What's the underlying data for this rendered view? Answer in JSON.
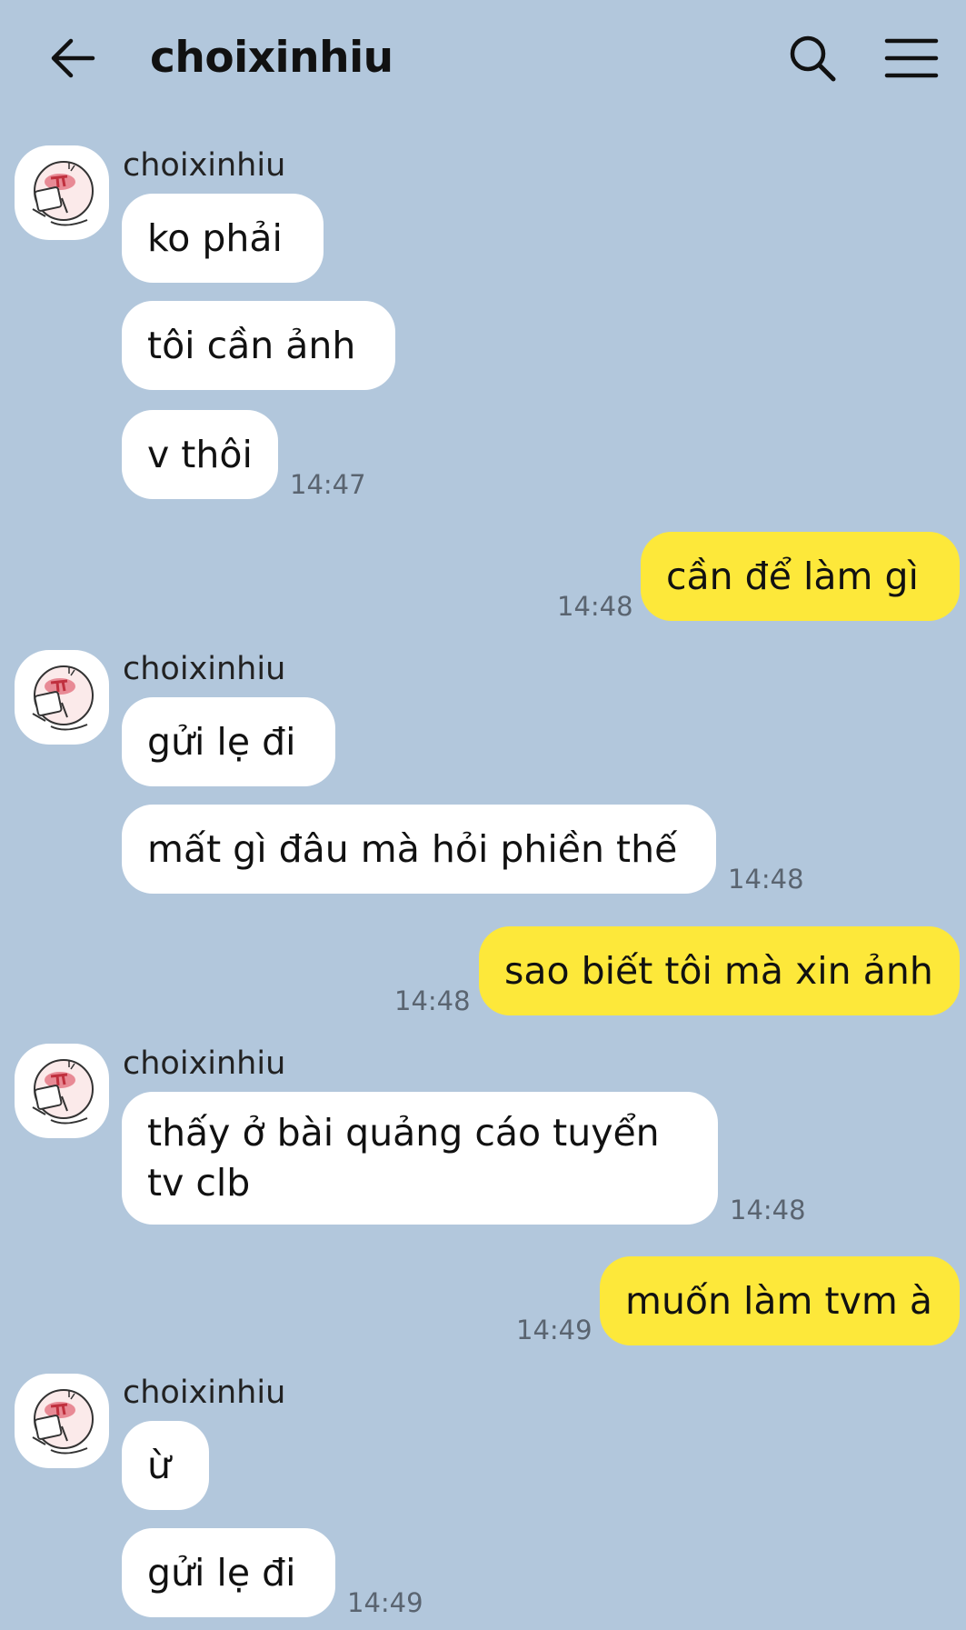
{
  "header": {
    "title": "choixinhiu",
    "back_icon": "arrow-left-icon",
    "search_icon": "search-icon",
    "menu_icon": "hamburger-menu-icon"
  },
  "colors": {
    "background": "#b2c7dc",
    "incoming_bubble": "#ffffff",
    "outgoing_bubble": "#fde83a",
    "timestamp": "#5a6470"
  },
  "messages": {
    "g1": {
      "sender": "choixinhiu",
      "m1": "ko phải",
      "m2": "tôi cần ảnh",
      "m3": "v thôi",
      "time": "14:47"
    },
    "o1": {
      "text": "cần để làm gì",
      "time": "14:48"
    },
    "g2": {
      "sender": "choixinhiu",
      "m1": "gửi lẹ đi",
      "m2": "mất gì đâu mà hỏi phiền thế",
      "time": "14:48"
    },
    "o2": {
      "text": "sao biết tôi mà xin ảnh",
      "time": "14:48"
    },
    "g3": {
      "sender": "choixinhiu",
      "m1": "thấy ở bài quảng cáo tuyển tv clb",
      "time": "14:48"
    },
    "o3": {
      "text": "muốn làm tvm à",
      "time": "14:49"
    },
    "g4": {
      "sender": "choixinhiu",
      "m1": "ừ",
      "m2": "gửi lẹ đi",
      "time": "14:49"
    }
  }
}
